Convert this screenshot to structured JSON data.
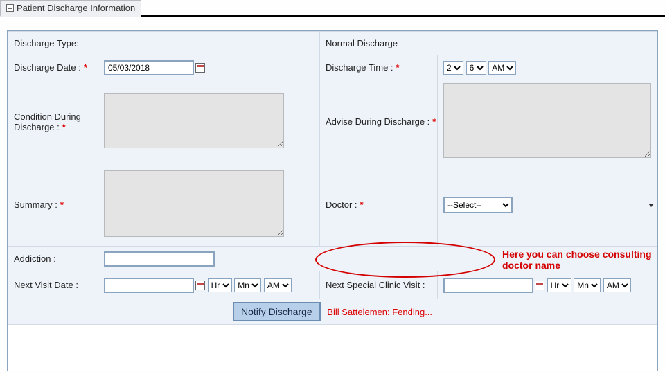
{
  "tab": {
    "title": "Patient Discharge Information"
  },
  "row_type": {
    "label": "Discharge Type:",
    "value": "Normal Discharge"
  },
  "row_date": {
    "label": "Discharge Date :",
    "value": "05/03/2018",
    "time_label": "Discharge Time :",
    "hr": "2",
    "min": "6",
    "ampm": "AM"
  },
  "row_cond": {
    "label_a": "Condition During",
    "label_b": "Discharge :",
    "advise_label": "Advise During Discharge :"
  },
  "row_summary": {
    "label": "Summary :",
    "doctor_label": "Doctor :",
    "doctor_value": "--Select--"
  },
  "row_addiction": {
    "label": "Addiction :"
  },
  "row_next": {
    "label": "Next Visit Date :",
    "hr": "Hr",
    "mn": "Mn",
    "ampm": "AM",
    "special_label": "Next Special Clinic Visit :"
  },
  "footer": {
    "button": "Notify Discharge",
    "status": "Bill Sattelemen: Fending..."
  },
  "annotation": {
    "text": "Here you can choose consulting doctor name"
  }
}
